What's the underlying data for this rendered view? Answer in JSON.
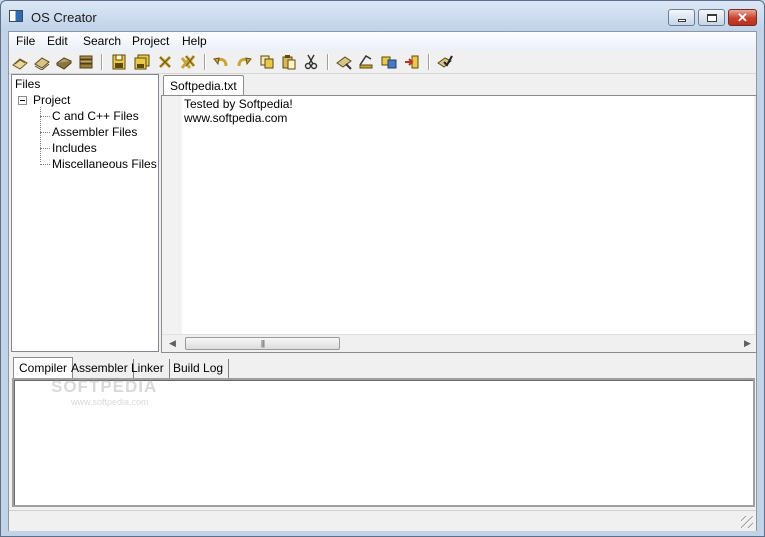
{
  "window": {
    "title": "OS Creator"
  },
  "menu": [
    "File",
    "Edit",
    "Search",
    "Project",
    "Help"
  ],
  "toolbar": {
    "buttons": [
      "open-icon",
      "open-project-icon",
      "close-book-icon",
      "books-icon",
      "save-icon",
      "save-all-icon",
      "close-icon",
      "close-all-icon",
      "undo-icon",
      "redo-icon",
      "copy-icon",
      "paste-icon",
      "cut-icon",
      "compile-icon",
      "assemble-icon",
      "link-icon",
      "run-icon",
      "build-check-icon"
    ]
  },
  "tree": {
    "header": "Files",
    "root": "Project",
    "children": [
      "C and C++ Files",
      "Assembler Files",
      "Includes",
      "Miscellaneous Files"
    ]
  },
  "editor": {
    "tab": "Softpedia.txt",
    "lines": [
      "Tested by Softpedia!",
      "www.softpedia.com"
    ]
  },
  "bottom_tabs": [
    "Compiler",
    "Assembler",
    "Linker",
    "Build Log"
  ],
  "watermark": {
    "main": "SOFTPEDIA",
    "sub": "www.softpedia.com"
  },
  "colors": {
    "accent": "#c3d3e7",
    "close_button": "#c7402a",
    "toolbar_icon": "#c8a536"
  }
}
